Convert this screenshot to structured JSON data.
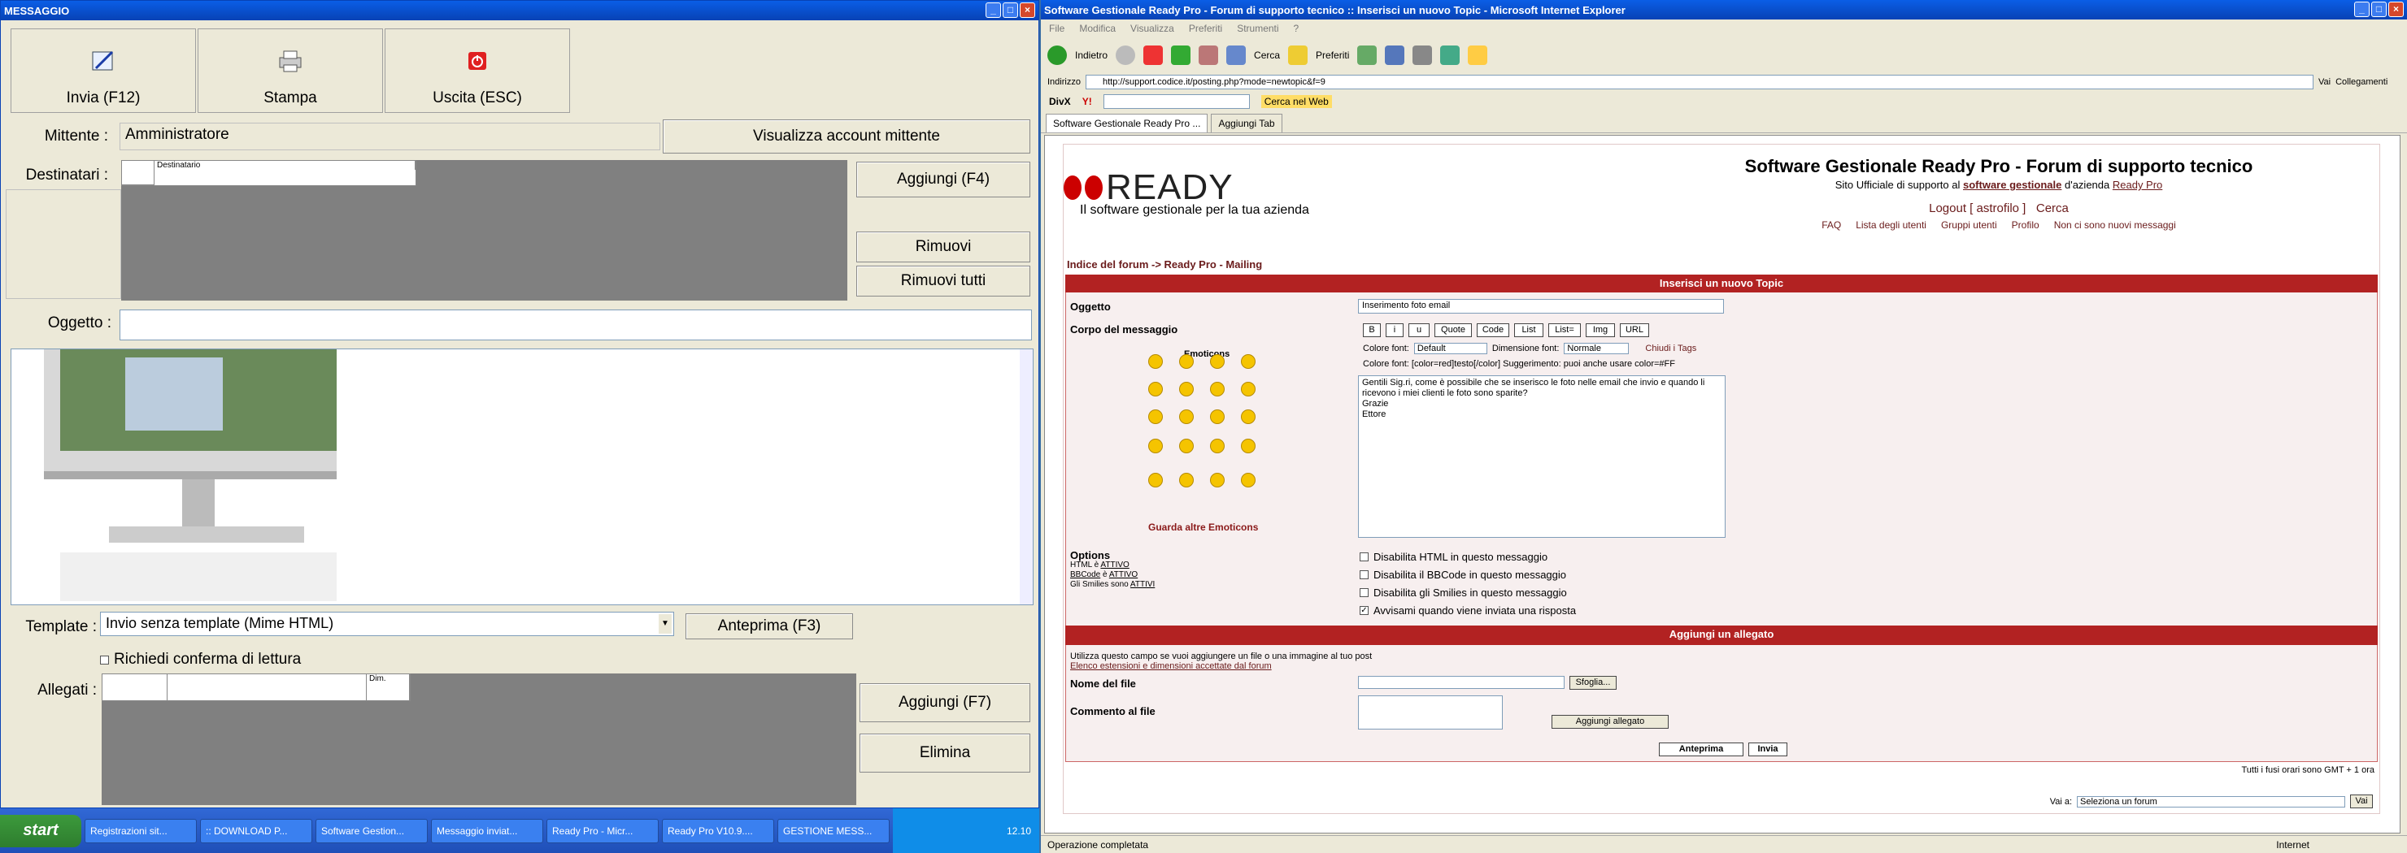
{
  "left": {
    "title": "MESSAGGIO",
    "toolbar": {
      "send": "Invia (F12)",
      "print": "Stampa",
      "exit": "Uscita (ESC)"
    },
    "mittente_label": "Mittente :",
    "mittente_value": "Amministratore",
    "view_account": "Visualizza account mittente",
    "destinatari_label": "Destinatari :",
    "dest_col": "Destinatario",
    "add_dest": "Aggiungi (F4)",
    "remove": "Rimuovi",
    "remove_all": "Rimuovi tutti",
    "oggetto_label": "Oggetto :",
    "template_label": "Template :",
    "template_value": "Invio senza template (Mime HTML)",
    "preview": "Anteprima (F3)",
    "read_receipt": "Richiedi conferma di lettura",
    "allegati_label": "Allegati :",
    "att_col_dim": "Dim.",
    "add_att": "Aggiungi (F7)",
    "delete": "Elimina"
  },
  "ie": {
    "title": "Software Gestionale Ready Pro - Forum di supporto tecnico :: Inserisci un nuovo Topic - Microsoft Internet Explorer",
    "menu": [
      "File",
      "Modifica",
      "Visualizza",
      "Preferiti",
      "Strumenti",
      "?"
    ],
    "back": "Indietro",
    "search": "Cerca",
    "fav": "Preferiti",
    "addr_label": "Indirizzo",
    "url": "http://support.codice.it/posting.php?mode=newtopic&f=9",
    "go": "Vai",
    "links": "Collegamenti",
    "divx": "DivX",
    "y": "Y!",
    "searchweb": "Cerca nel Web",
    "tab1": "Software Gestionale Ready Pro ...",
    "tab_add": "Aggiungi Tab",
    "status": "Operazione completata",
    "zone": "Internet"
  },
  "forum": {
    "logo": "READY",
    "tagline": "Il software gestionale per la tua azienda",
    "heading": "Software Gestionale Ready Pro - Forum di supporto tecnico",
    "sub1": "Sito Ufficiale di supporto al ",
    "sub_link1": "software gestionale",
    "sub2": " d'azienda ",
    "sub_link2": "Ready Pro",
    "logout": "Logout [ astrofilo ]",
    "cerca": "Cerca",
    "nav": [
      "FAQ",
      "Lista degli utenti",
      "Gruppi utenti",
      "Profilo",
      "Non ci sono nuovi messaggi"
    ],
    "breadcrumb": "Indice del forum -> Ready Pro - Mailing",
    "section1": "Inserisci un nuovo Topic",
    "oggetto_label": "Oggetto",
    "oggetto_value": "Inserimento foto email",
    "corpo_label": "Corpo del messaggio",
    "fmt": [
      "B",
      "i",
      "u",
      "Quote",
      "Code",
      "List",
      "List=",
      "Img",
      "URL"
    ],
    "emoticons": "Emoticons",
    "more_emo": "Guarda altre Emoticons",
    "color_label": "Colore font:",
    "color_value": "Default",
    "size_label": "Dimensione font:",
    "size_value": "Normale",
    "close_tags": "Chiudi i Tags",
    "hint": "Colore font: [color=red]testo[/color]  Suggerimento: puoi anche usare color=#FF",
    "body": "Gentili Sig.ri, come è possibile che se inserisco le foto nelle email che invio e quando li ricevono i miei clienti le foto sono sparite?\nGrazie\nEttore",
    "options": "Options",
    "html_on": "HTML è ",
    "attivo": "ATTIVO",
    "bbcode": "BBCode",
    "is": " è ",
    "smilies": "Gli Smilies sono ",
    "attivi": "ATTIVI",
    "opt": [
      "Disabilita HTML in questo messaggio",
      "Disabilita il BBCode in questo messaggio",
      "Disabilita gli Smilies in questo messaggio",
      "Avvisami quando viene inviata una risposta"
    ],
    "section2": "Aggiungi un allegato",
    "att_info": "Utilizza questo campo se vuoi aggiungere un file o una immagine al tuo post",
    "att_link": "Elenco estensioni e dimensioni accettate dal forum",
    "file_label": "Nome del file",
    "browse": "Sfoglia...",
    "comment_label": "Commento al file",
    "add_att": "Aggiungi allegato",
    "preview": "Anteprima",
    "send": "Invia",
    "tz": "Tutti i fusi orari sono GMT + 1 ora",
    "jump": "Vai a:",
    "jump_value": "Seleziona un forum",
    "jump_go": "Vai"
  },
  "taskbar": {
    "start": "start",
    "tasks": [
      "Registrazioni sit...",
      ":: DOWNLOAD P...",
      "Software Gestion...",
      "Messaggio inviat...",
      "Ready Pro - Micr...",
      "Ready Pro V10.9....",
      "GESTIONE MESS..."
    ],
    "clock": "12.10"
  }
}
